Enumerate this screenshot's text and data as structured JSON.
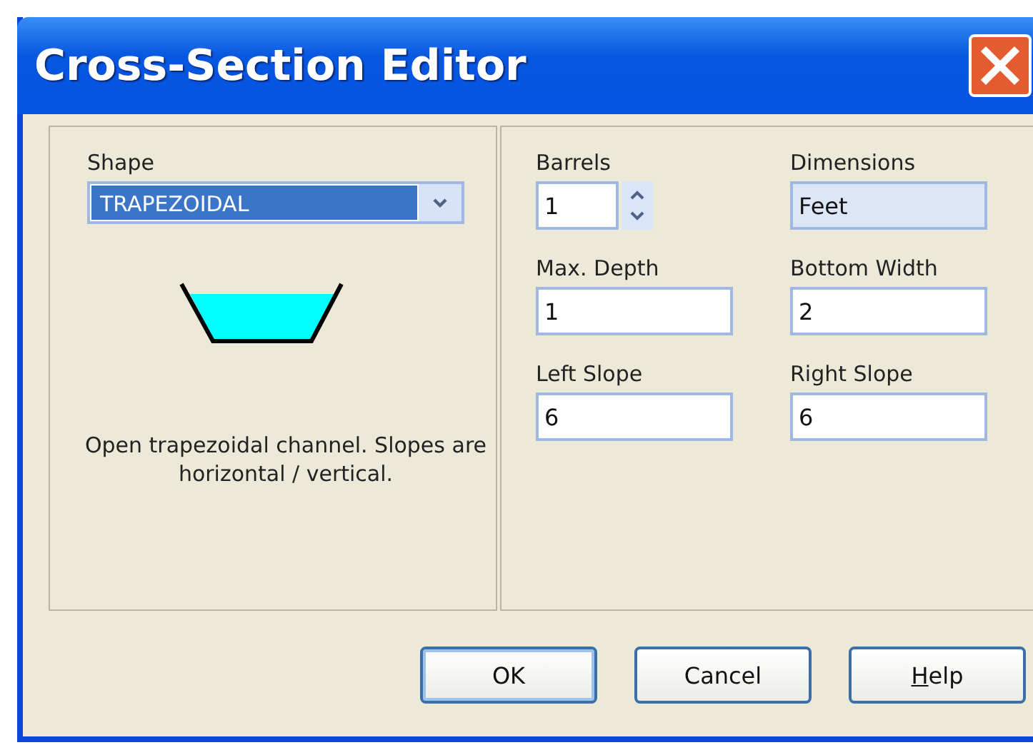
{
  "window": {
    "title": "Cross-Section Editor"
  },
  "shape": {
    "label": "Shape",
    "value": "TRAPEZOIDAL",
    "description": "Open trapezoidal channel. Slopes are horizontal / vertical."
  },
  "fields": [
    {
      "label": "Barrels",
      "value": "1",
      "kind": "spin"
    },
    {
      "label": "Dimensions",
      "value": "Feet",
      "kind": "readonly"
    },
    {
      "label": "Max. Depth",
      "value": "1",
      "kind": "text"
    },
    {
      "label": "Bottom Width",
      "value": "2",
      "kind": "text"
    },
    {
      "label": "Left Slope",
      "value": "6",
      "kind": "text"
    },
    {
      "label": "Right Slope",
      "value": "6",
      "kind": "text"
    }
  ],
  "buttons": [
    {
      "label": "OK",
      "default": true,
      "mnemonic_first": false
    },
    {
      "label": "Cancel",
      "default": false,
      "mnemonic_first": false
    },
    {
      "label": "Help",
      "default": false,
      "mnemonic_first": true
    }
  ]
}
